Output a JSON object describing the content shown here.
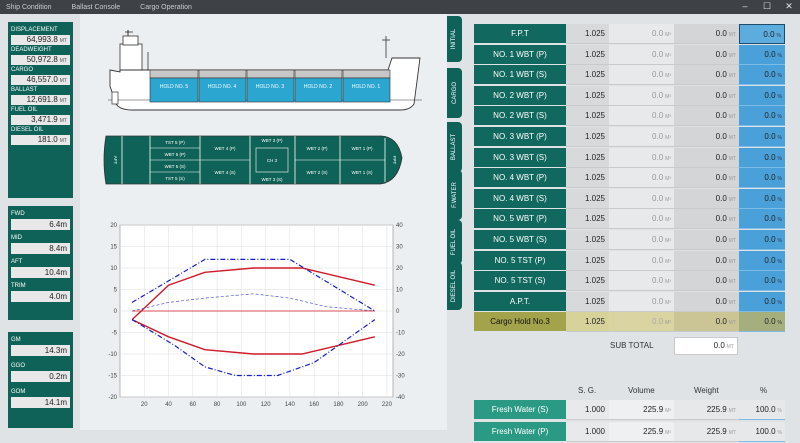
{
  "titlebar": {
    "menus": [
      "Ship Condition",
      "Ballast Console",
      "Cargo Operation"
    ],
    "minimize": "–",
    "maximize": "☐",
    "close": "✕"
  },
  "summary": {
    "displacement": {
      "label": "DISPLACEMENT",
      "value": "64,993.8",
      "unit": "MT"
    },
    "deadweight": {
      "label": "DEADWEIGHT",
      "value": "50,972.8",
      "unit": "MT"
    },
    "cargo": {
      "label": "CARGO",
      "value": "46,557.0",
      "unit": "MT"
    },
    "ballast": {
      "label": "BALLAST",
      "value": "12,691.8",
      "unit": "MT"
    },
    "fuel_oil": {
      "label": "FUEL OIL",
      "value": "3,471.9",
      "unit": "MT"
    },
    "diesel_oil": {
      "label": "DIESEL OIL",
      "value": "181.0",
      "unit": "MT"
    }
  },
  "drafts": {
    "fwd": {
      "label": "FWD",
      "value": "6.4",
      "unit": "m"
    },
    "mid": {
      "label": "MID",
      "value": "8.4",
      "unit": "m"
    },
    "aft": {
      "label": "AFT",
      "value": "10.4",
      "unit": "m"
    },
    "trim": {
      "label": "TRIM",
      "value": "4.0",
      "unit": "m"
    }
  },
  "stability": {
    "gm": {
      "label": "GM",
      "value": "14.3",
      "unit": "m"
    },
    "ggo": {
      "label": "GGO",
      "value": "0.2",
      "unit": "m"
    },
    "gom": {
      "label": "GOM",
      "value": "14.1",
      "unit": "m"
    }
  },
  "profile": {
    "holds": [
      "HOLD NO. 5",
      "HOLD NO. 4",
      "HOLD NO. 3",
      "HOLD NO. 2",
      "HOLD NO. 1"
    ]
  },
  "plan": {
    "aft": "AFT",
    "fpt": "FPT",
    "ch3": "CH 3",
    "tst5p": "TST 5 (P)",
    "wbt5p": "WBT 5 (P)",
    "wbt5s": "WBT 5 (S)",
    "tst5s": "TST 5 (S)",
    "wbt4p": "WBT 4 (P)",
    "wbt4s": "WBT 4 (S)",
    "wbt3p": "WBT 3 (P)",
    "wbt3s": "WBT 3 (S)",
    "wbt2p": "WBT 2 (P)",
    "wbt2s": "WBT 2 (S)",
    "wbt1p": "WBT 1 (P)",
    "wbt1s": "WBT 1 (S)"
  },
  "tabs": [
    "INITIAL",
    "CARGO",
    "BALLAST",
    "F.WATER",
    "FUEL OIL",
    "DIESEL OIL"
  ],
  "tanks": [
    {
      "name": "F.P.T",
      "sg": "1.025",
      "vol": "0.0",
      "wt": "0.0",
      "pct": "0.0"
    },
    {
      "name": "NO. 1 WBT (P)",
      "sg": "1.025",
      "vol": "0.0",
      "wt": "0.0",
      "pct": "0.0"
    },
    {
      "name": "NO. 1 WBT (S)",
      "sg": "1.025",
      "vol": "0.0",
      "wt": "0.0",
      "pct": "0.0"
    },
    {
      "name": "NO. 2 WBT (P)",
      "sg": "1.025",
      "vol": "0.0",
      "wt": "0.0",
      "pct": "0.0"
    },
    {
      "name": "NO. 2 WBT (S)",
      "sg": "1.025",
      "vol": "0.0",
      "wt": "0.0",
      "pct": "0.0"
    },
    {
      "name": "NO. 3 WBT (P)",
      "sg": "1.025",
      "vol": "0.0",
      "wt": "0.0",
      "pct": "0.0"
    },
    {
      "name": "NO. 3 WBT (S)",
      "sg": "1.025",
      "vol": "0.0",
      "wt": "0.0",
      "pct": "0.0"
    },
    {
      "name": "NO. 4 WBT (P)",
      "sg": "1.025",
      "vol": "0.0",
      "wt": "0.0",
      "pct": "0.0"
    },
    {
      "name": "NO. 4 WBT (S)",
      "sg": "1.025",
      "vol": "0.0",
      "wt": "0.0",
      "pct": "0.0"
    },
    {
      "name": "NO. 5 WBT (P)",
      "sg": "1.025",
      "vol": "0.0",
      "wt": "0.0",
      "pct": "0.0"
    },
    {
      "name": "NO. 5 WBT (S)",
      "sg": "1.025",
      "vol": "0.0",
      "wt": "0.0",
      "pct": "0.0"
    },
    {
      "name": "NO. 5 TST (P)",
      "sg": "1.025",
      "vol": "0.0",
      "wt": "0.0",
      "pct": "0.0"
    },
    {
      "name": "NO. 5 TST (S)",
      "sg": "1.025",
      "vol": "0.0",
      "wt": "0.0",
      "pct": "0.0"
    },
    {
      "name": "A.P.T.",
      "sg": "1.025",
      "vol": "0.0",
      "wt": "0.0",
      "pct": "0.0"
    },
    {
      "name": "Cargo Hold No.3",
      "sg": "1.025",
      "vol": "0.0",
      "wt": "0.0",
      "pct": "0.0"
    }
  ],
  "units": {
    "vol": "M³",
    "wt": "MT",
    "pct": "%"
  },
  "subtotal": {
    "label": "SUB TOTAL",
    "value": "0.0",
    "unit": "MT"
  },
  "second_header": {
    "sg": "S. G.",
    "vol": "Volume",
    "wt": "Weight",
    "pct": "%"
  },
  "fw": [
    {
      "name": "Fresh Water (S)",
      "sg": "1.000",
      "vol": "225.9",
      "wt": "225.9",
      "pct": "100.0"
    },
    {
      "name": "Fresh Water (P)",
      "sg": "1.000",
      "vol": "225.9",
      "wt": "225.9",
      "pct": "100.0"
    }
  ],
  "chart_data": {
    "type": "line",
    "xticks": [
      20,
      40,
      60,
      80,
      100,
      120,
      140,
      160,
      180,
      200,
      220
    ],
    "yticks_left": [
      20,
      15,
      10,
      5,
      0,
      -5,
      -10,
      -15,
      -20
    ],
    "yticks_right": [
      40,
      30,
      20,
      10,
      0,
      -10,
      -20,
      -30,
      -40
    ],
    "xlim": [
      0,
      225
    ],
    "ylim": [
      -20,
      20
    ],
    "y2lim": [
      -40,
      40
    ],
    "series": [
      {
        "color": "#d11a2a",
        "style": "solid",
        "x": [
          10,
          40,
          70,
          110,
          150,
          210
        ],
        "y": [
          -2,
          6,
          9,
          10,
          10,
          6
        ]
      },
      {
        "color": "#d11a2a",
        "style": "solid",
        "x": [
          10,
          40,
          70,
          110,
          150,
          210
        ],
        "y": [
          -2,
          -6,
          -9,
          -10,
          -10,
          -6
        ]
      },
      {
        "color": "#1720c6",
        "style": "dashdot",
        "x": [
          10,
          70,
          140,
          210
        ],
        "y": [
          2,
          12,
          12,
          0
        ]
      },
      {
        "color": "#1720c6",
        "style": "dashdot",
        "x": [
          10,
          45,
          70,
          95,
          130,
          160,
          210
        ],
        "y": [
          -2,
          -8,
          -13,
          -15,
          -15,
          -12,
          -2
        ]
      },
      {
        "color": "#4a55d0",
        "style": "dashed",
        "x": [
          10,
          40,
          70,
          110,
          140,
          170,
          210
        ],
        "y": [
          0,
          2,
          3,
          4,
          3,
          1,
          0
        ]
      },
      {
        "color": "#d11a2a",
        "style": "thin",
        "x": [
          10,
          210
        ],
        "y": [
          0,
          0
        ]
      }
    ]
  }
}
